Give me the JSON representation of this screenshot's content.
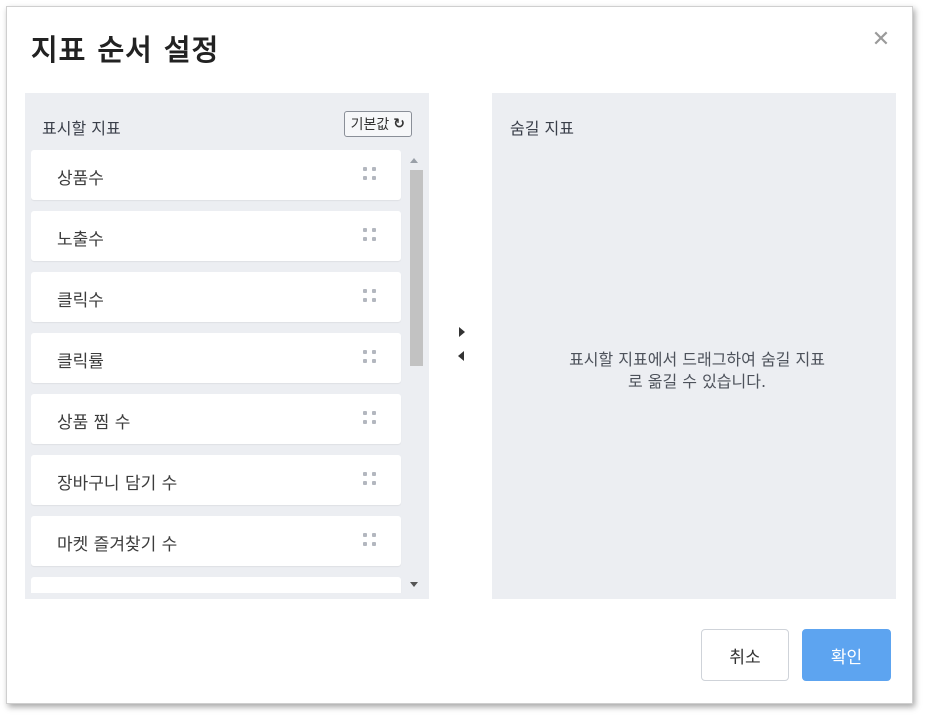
{
  "dialog": {
    "title": "지표 순서 설정",
    "close_icon": "close-icon",
    "close_glyph": "✕"
  },
  "visible_panel": {
    "label": "표시할 지표",
    "reset_label": "기본값",
    "reset_icon": "refresh-icon",
    "reset_glyph": "↻",
    "items": [
      {
        "label": "상품수"
      },
      {
        "label": "노출수"
      },
      {
        "label": "클릭수"
      },
      {
        "label": "클릭률"
      },
      {
        "label": "상품 찜 수"
      },
      {
        "label": "장바구니 담기 수"
      },
      {
        "label": "마켓 즐겨찾기 수"
      },
      {
        "label": ""
      }
    ]
  },
  "hidden_panel": {
    "label": "숨길 지표",
    "empty_message": "표시할 지표에서 드래그하여 숨길 지표로 옮길 수 있습니다."
  },
  "footer": {
    "cancel_label": "취소",
    "confirm_label": "확인"
  },
  "colors": {
    "panel_bg": "#eceef2",
    "confirm_bg": "#5da4f0",
    "drag_dot": "#b3b7bf"
  }
}
